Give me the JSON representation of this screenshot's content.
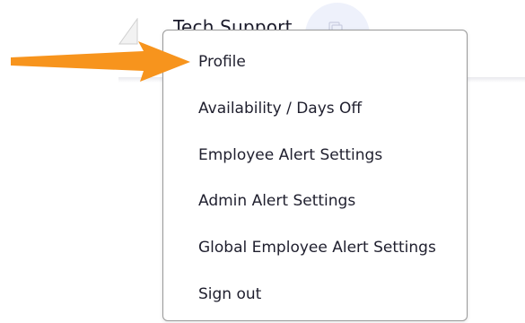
{
  "header": {
    "title": "Tech Support"
  },
  "menu": {
    "items": [
      {
        "label": "Profile"
      },
      {
        "label": "Availability / Days Off"
      },
      {
        "label": "Employee Alert Settings"
      },
      {
        "label": "Admin Alert Settings"
      },
      {
        "label": "Global Employee Alert Settings"
      },
      {
        "label": "Sign out"
      }
    ]
  },
  "annotation": {
    "arrow_color": "#f7941d",
    "arrow_target": "Profile"
  },
  "icons": {
    "collapse": "collapse-icon",
    "avatar": "user-icon"
  }
}
